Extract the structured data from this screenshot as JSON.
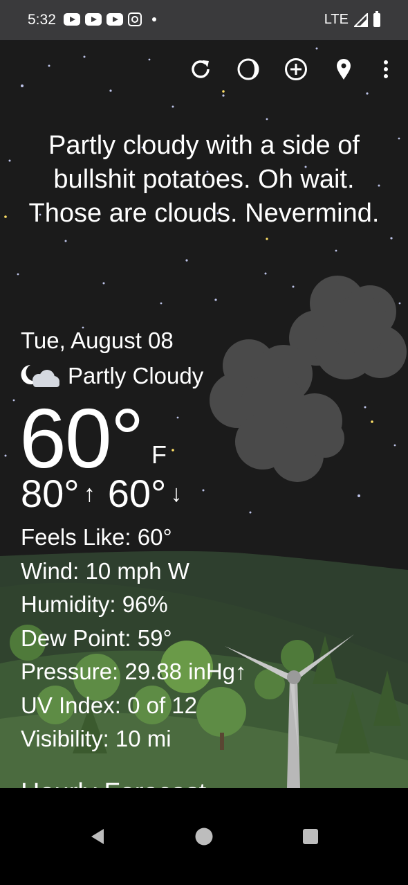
{
  "status_bar": {
    "time": "5:32",
    "network": "LTE",
    "icons": [
      "youtube-icon",
      "youtube-icon",
      "youtube-icon",
      "instagram-icon",
      "notification-dot-icon",
      "signal-icon",
      "battery-icon"
    ]
  },
  "toolbar": {
    "buttons": [
      "refresh-icon",
      "moon-phase-icon",
      "add-location-icon",
      "location-pin-icon",
      "overflow-menu-icon"
    ]
  },
  "quip": "Partly cloudy with a side of bullshit potatoes. Oh wait. Those are clouds. Nevermind.",
  "forecast": {
    "date": "Tue, August 08",
    "condition": "Partly Cloudy",
    "condition_icon": "partly-cloudy-night-icon",
    "temperature": "60°",
    "unit": "F",
    "high": "80°",
    "low": "60°",
    "high_arrow": "↑",
    "low_arrow": "↓"
  },
  "details": {
    "feels_like": "Feels Like:  60°",
    "wind": "Wind:  10 mph W",
    "humidity": "Humidity:  96%",
    "dew_point": "Dew Point:  59°",
    "pressure": "Pressure:  29.88 inHg↑",
    "uv_index": "UV Index:  0 of 12",
    "visibility": "Visibility:  10 mi"
  },
  "next_section_title": "Hourly Forecast",
  "nav": [
    "back-icon",
    "home-icon",
    "recents-icon"
  ],
  "colors": {
    "sky": "#1b1b1b",
    "status_bar": "#3a3a3c",
    "cloud": "#4a4a4a",
    "hill": "#3d5a36",
    "text": "#ffffff"
  }
}
